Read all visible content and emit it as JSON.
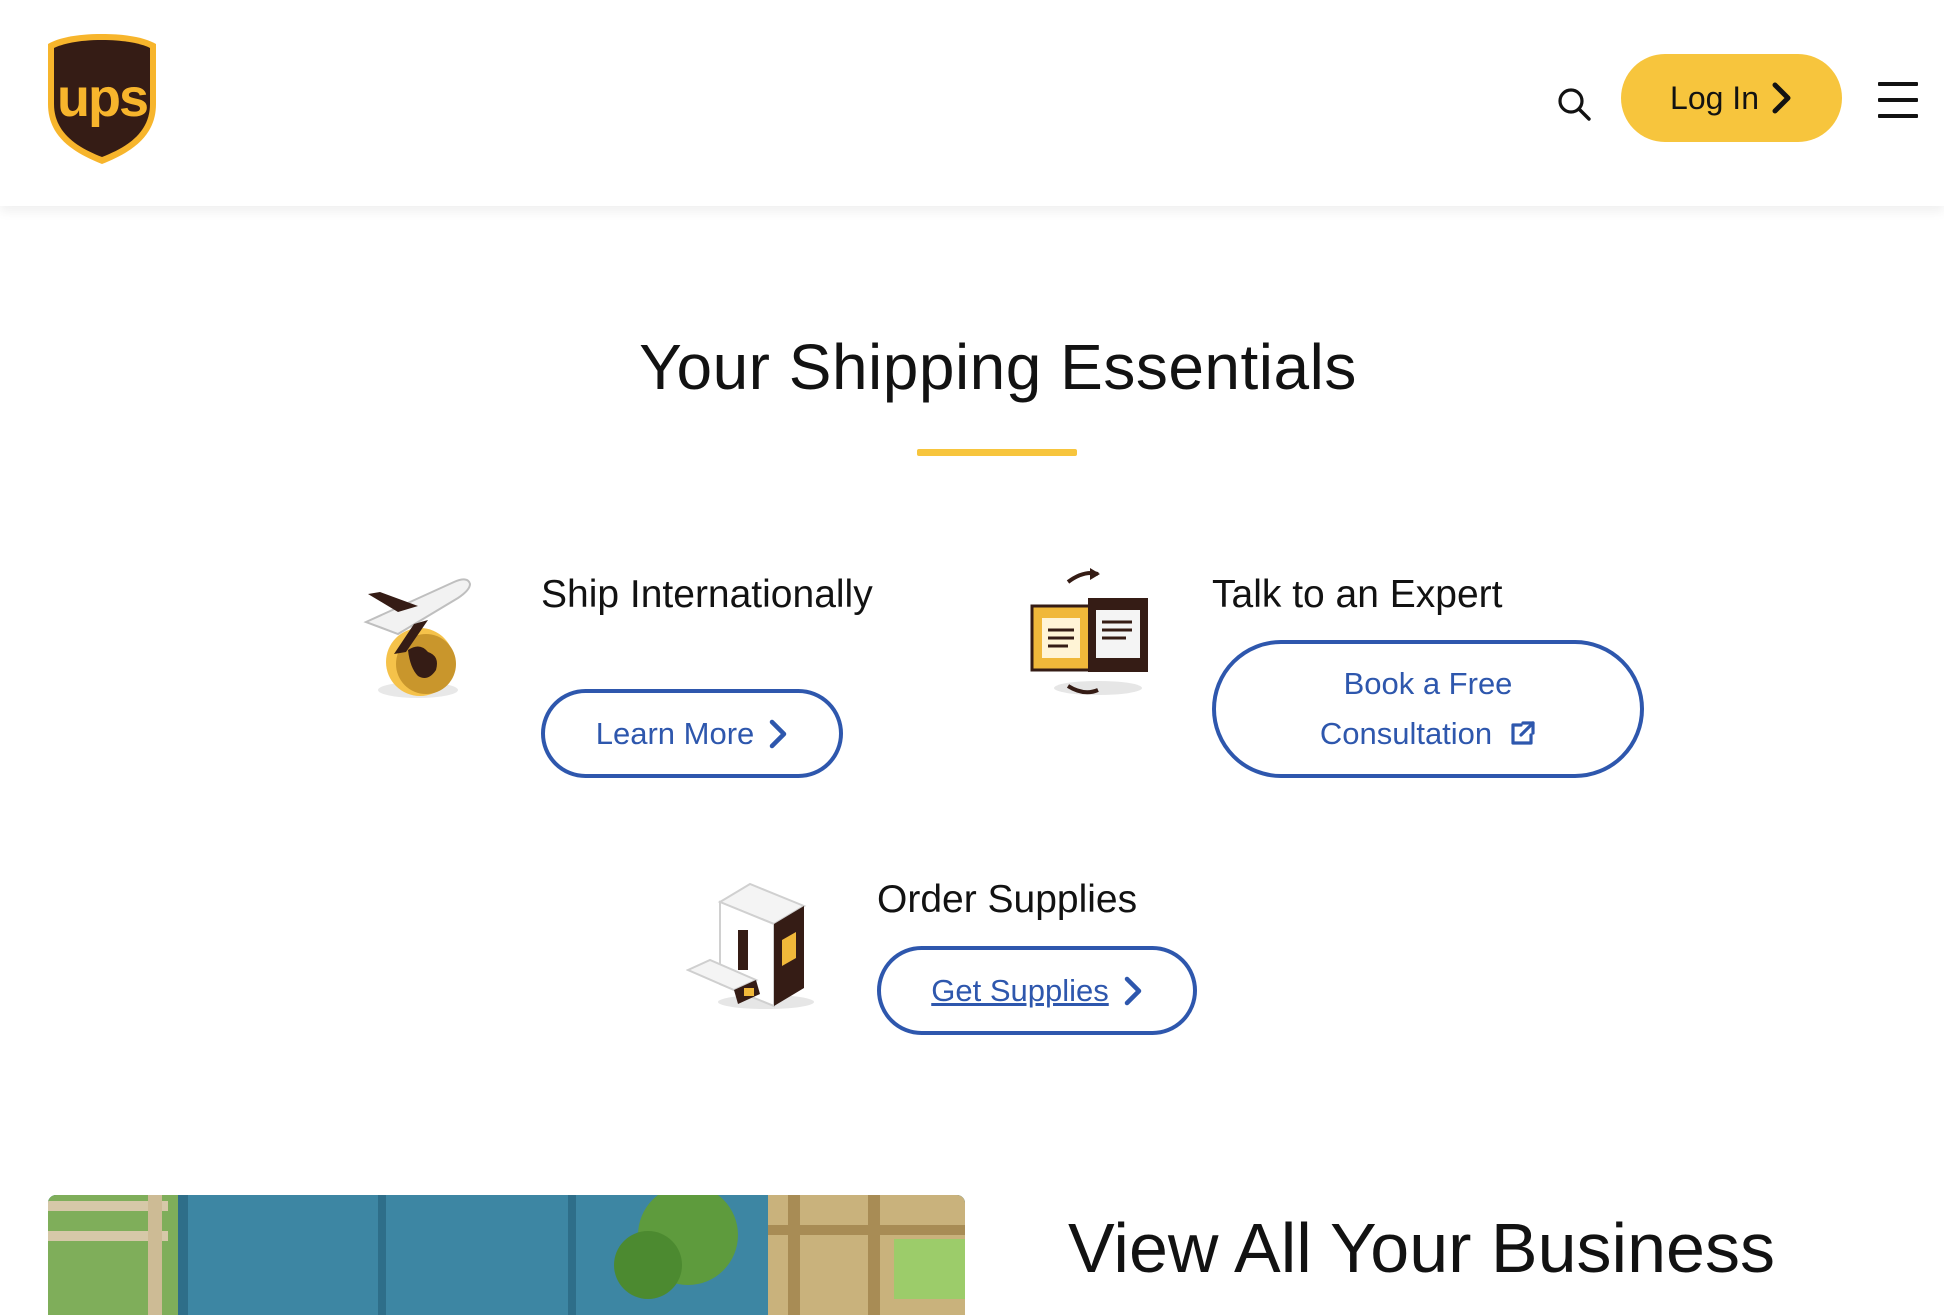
{
  "header": {
    "logo_text": "ups",
    "login_label": "Log In"
  },
  "section": {
    "title": "Your Shipping Essentials",
    "accent_color": "#f7c53d"
  },
  "features": [
    {
      "title": "Ship Internationally",
      "button_label": "Learn More",
      "icon": "plane-globe-icon"
    },
    {
      "title": "Talk to an Expert",
      "button_line1": "Book a Free",
      "button_line2": "Consultation",
      "icon": "chat-screens-icon"
    },
    {
      "title": "Order Supplies",
      "button_label": "Get Supplies",
      "icon": "supply-boxes-icon"
    }
  ],
  "bottom": {
    "title": "View All Your Business"
  },
  "colors": {
    "brand_brown": "#351c15",
    "brand_gold": "#f7c53d",
    "link_blue": "#2e57ad"
  }
}
